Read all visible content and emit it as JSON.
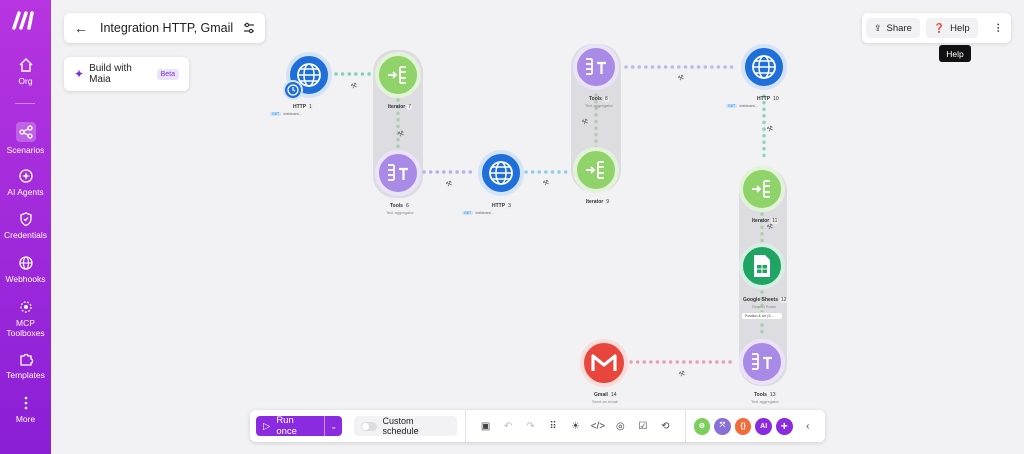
{
  "sidebar": {
    "logo": "make-logo",
    "items": [
      {
        "label": "Org",
        "icon": "home-icon"
      },
      {
        "label": "Scenarios",
        "icon": "share-nodes-icon"
      },
      {
        "label": "AI Agents",
        "icon": "sparkle-icon"
      },
      {
        "label": "Credentials",
        "icon": "shield-icon"
      },
      {
        "label": "Webhooks",
        "icon": "globe-icon"
      },
      {
        "label": "MCP",
        "label2": "Toolboxes",
        "icon": "mcp-icon"
      },
      {
        "label": "Templates",
        "icon": "puzzle-icon"
      },
      {
        "label": "More",
        "icon": "dots-vertical-icon"
      }
    ]
  },
  "header": {
    "title": "Integration HTTP, Gmail"
  },
  "maia": {
    "label": "Build with Maia",
    "badge": "Beta"
  },
  "topbar": {
    "share": "Share",
    "help": "Help",
    "tooltip": "Help"
  },
  "nodes": {
    "http1": {
      "label": "HTTP",
      "badge": "1",
      "url": "/webinars/...",
      "method": "GET"
    },
    "iter1": {
      "label": "Iterator",
      "badge": "7"
    },
    "tools1": {
      "label": "Tools",
      "badge": "6",
      "sub": "Text aggregator"
    },
    "http2": {
      "label": "HTTP",
      "badge": "3",
      "url": "/webinars/...",
      "method": "GET"
    },
    "iter2": {
      "label": "Iterator",
      "badge": "9"
    },
    "tools2": {
      "label": "Tools",
      "badge": "8",
      "sub": "Text aggregator"
    },
    "http3": {
      "label": "HTTP",
      "badge": "10",
      "url": "/webinars/...",
      "method": "GET"
    },
    "iter3": {
      "label": "Iterator",
      "badge": "11"
    },
    "gsheets": {
      "label": "Google Sheets",
      "badge": "12",
      "sub": "Search Rows",
      "chip": "Position & Url (S..."
    },
    "tools3": {
      "label": "Tools",
      "badge": "13",
      "sub": "Text aggregator"
    },
    "gmail": {
      "label": "Gmail",
      "badge": "14",
      "sub": "Send an email"
    }
  },
  "toolbar": {
    "run": "Run once",
    "schedule": "Custom schedule",
    "apps": [
      {
        "name": "settings-app",
        "color": "#7ccf5a",
        "text": ""
      },
      {
        "name": "flow-app",
        "color": "#8a6fd9",
        "text": ""
      },
      {
        "name": "brackets-app",
        "color": "#f26b3a",
        "text": "{}"
      },
      {
        "name": "ai-app",
        "color": "#8a2be2",
        "text": "AI"
      }
    ]
  }
}
